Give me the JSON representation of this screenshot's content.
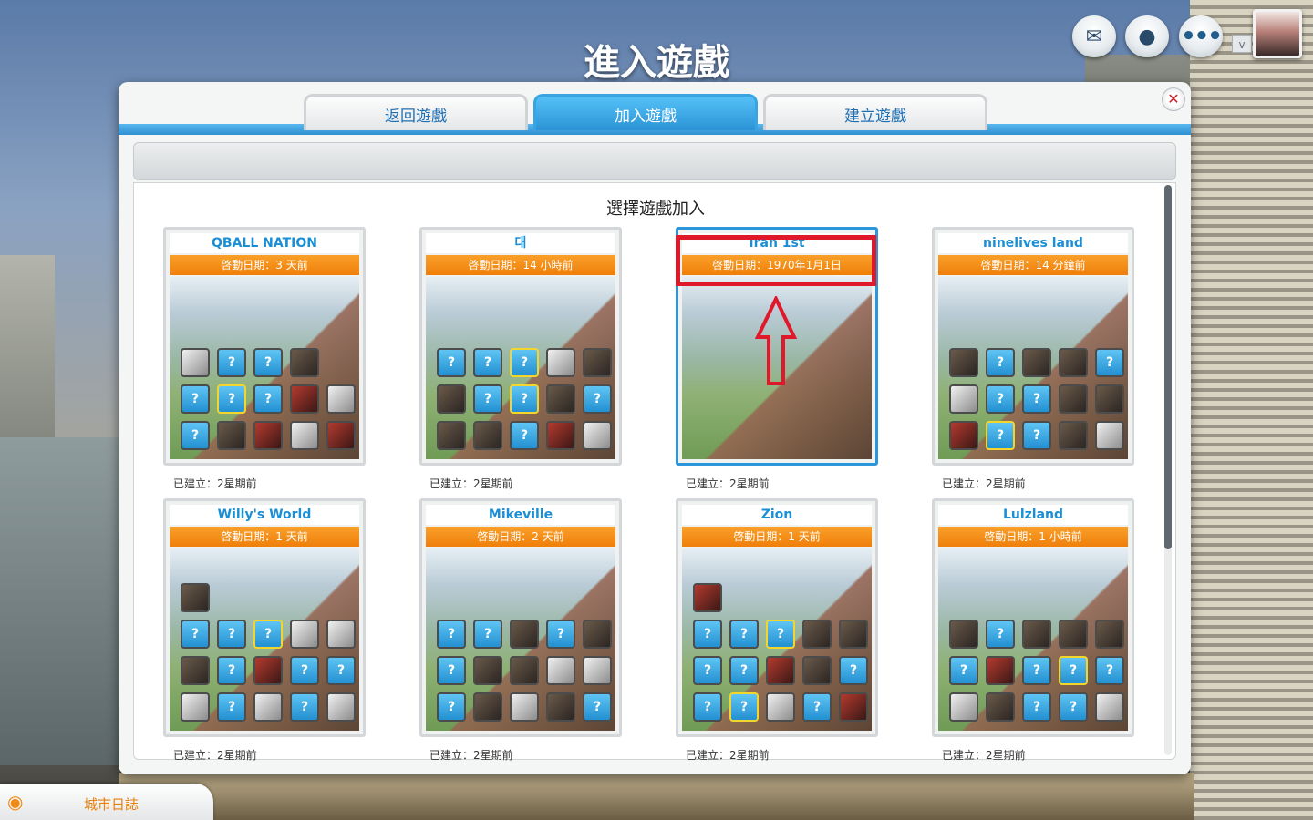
{
  "title": "進入遊戲",
  "tabs": {
    "back": "返回遊戲",
    "join": "加入遊戲",
    "create": "建立遊戲"
  },
  "close": "✕",
  "section_title": "選擇遊戲加入",
  "top_controls": {
    "more_glyph": "•••",
    "caret": "v"
  },
  "games": [
    {
      "name": "QBALL NATION",
      "launch": "啓動日期：3 天前",
      "created": "已建立：2星期前"
    },
    {
      "name": "대",
      "launch": "啓動日期：14 小時前",
      "created": "已建立：2星期前"
    },
    {
      "name": "Iran 1st",
      "launch": "啓動日期：1970年1月1日",
      "created": "已建立：2星期前"
    },
    {
      "name": "ninelives land",
      "launch": "啓動日期：14 分鐘前",
      "created": "已建立：2星期前"
    },
    {
      "name": "Willy's World",
      "launch": "啓動日期：1 天前",
      "created": "已建立：2星期前"
    },
    {
      "name": "Mikeville",
      "launch": "啓動日期：2 天前",
      "created": "已建立：2星期前"
    },
    {
      "name": "Zion",
      "launch": "啓動日期：1 天前",
      "created": "已建立：2星期前"
    },
    {
      "name": "Lulzland",
      "launch": "啓動日期：1 小時前",
      "created": "已建立：2星期前"
    }
  ],
  "city_log": "城市日誌",
  "icons": {
    "mail": "mail-icon",
    "social": "friends-icon",
    "more": "more-icon",
    "close": "close-icon",
    "city_log": "broadcast-icon",
    "slot_empty": "?"
  },
  "colors": {
    "accent": "#2b96d9",
    "orange": "#ef7f0a",
    "highlight": "#e0192a"
  }
}
